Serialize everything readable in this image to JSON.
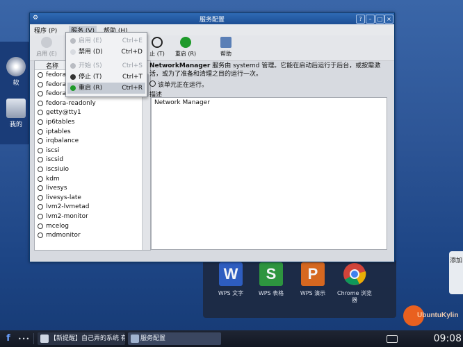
{
  "desktop": {
    "icons": [
      {
        "label": "软"
      },
      {
        "label": "我的"
      }
    ],
    "dock": [
      {
        "label": "WPS 文字",
        "glyph": "W",
        "color": "#2f5fc4"
      },
      {
        "label": "WPS 表格",
        "glyph": "S",
        "color": "#2f9a3c"
      },
      {
        "label": "WPS 演示",
        "glyph": "P",
        "color": "#e06a1b"
      },
      {
        "label": "Chrome 浏览器",
        "glyph": "",
        "color": "#ffffff"
      }
    ],
    "right_tab": "添加"
  },
  "window": {
    "title": "服务配置",
    "menus": [
      "程序 (P)",
      "服务 (V)",
      "帮助 (H)"
    ],
    "toolbar": [
      {
        "label": "启用 (E)",
        "icon": "enable-icon",
        "enabled": false
      },
      {
        "label": "止 (T)",
        "icon": "stop-icon",
        "enabled": true
      },
      {
        "label": "重启 (R)",
        "icon": "restart-icon",
        "enabled": true
      },
      {
        "label": "帮助",
        "icon": "help-icon",
        "enabled": true
      }
    ],
    "list": {
      "header": "名称",
      "items": [
        "fedora-",
        "fedora-",
        "fedora-",
        "fedora-readonly",
        "getty@tty1",
        "ip6tables",
        "iptables",
        "irqbalance",
        "iscsi",
        "iscsid",
        "iscsiuio",
        "kdm",
        "livesys",
        "livesys-late",
        "lvm2-lvmetad",
        "lvm2-monitor",
        "mcelog",
        "mdmonitor"
      ]
    },
    "details": {
      "service_name": "NetworkManager",
      "description_line": " 服务由 systemd 管理。它能在启动后运行于后台，或按需激活，或为了准备和清理之目的运行一次。",
      "status": "该单元正在运行。",
      "desc_label": "描述",
      "desc_text": "Network Manager"
    },
    "dropdown": [
      {
        "label": "启用 (E)",
        "shortcut": "Ctrl+E",
        "enabled": false,
        "icon_color": "#b9bcc2"
      },
      {
        "label": "禁用 (D)",
        "shortcut": "Ctrl+D",
        "enabled": true,
        "icon_color": "#d8dbe0"
      },
      {
        "label": "开始 (S)",
        "shortcut": "Ctrl+S",
        "enabled": false,
        "icon_color": "#b9bcc2"
      },
      {
        "label": "停止 (T)",
        "shortcut": "Ctrl+T",
        "enabled": true,
        "icon_color": "#333333"
      },
      {
        "label": "重启 (R)",
        "shortcut": "Ctrl+R",
        "enabled": true,
        "icon_color": "#1e9a2a"
      }
    ]
  },
  "taskbar": {
    "start_glyph": "f",
    "tasks": [
      "【新提醒】自己弄的系统 有点",
      "服务配置"
    ],
    "clock": "09:08"
  },
  "watermark": "UbuntuKylin"
}
